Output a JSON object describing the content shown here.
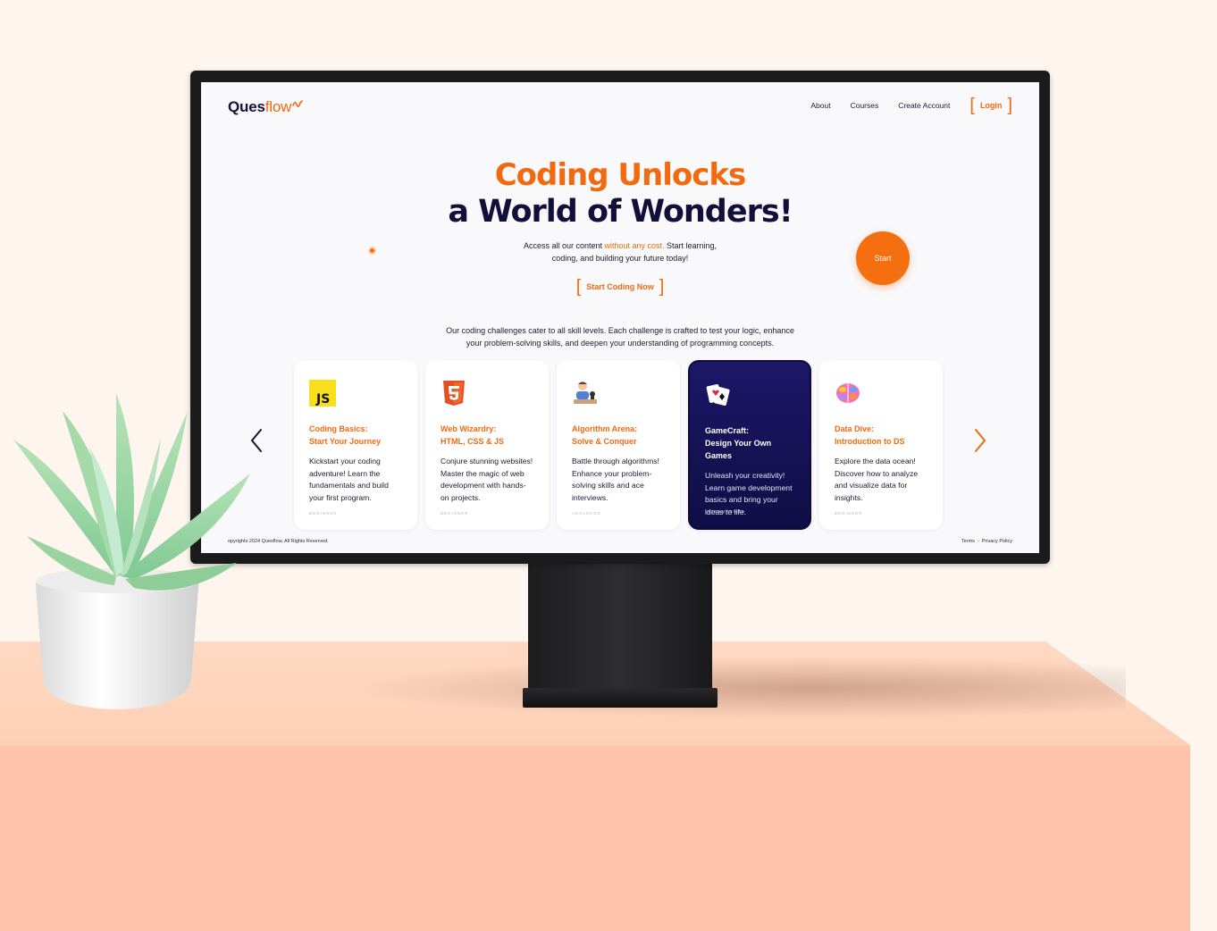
{
  "site": {
    "logo_main": "Ques",
    "logo_accent": "flow"
  },
  "nav": {
    "about": "About",
    "courses": "Courses",
    "create_account": "Create Account",
    "login": "Login"
  },
  "hero": {
    "title_line1": "Coding Unlocks",
    "title_line2": "a World of Wonders!",
    "sub_before": "Access all our content ",
    "sub_highlight": "without any cost.",
    "sub_after": " Start learning,",
    "sub_line2": "coding, and building your future today!",
    "cta_label": "Start Coding Now",
    "start_button": "Start"
  },
  "intro": {
    "line1": "Our coding challenges cater to all skill levels. Each challenge is crafted to test your logic, enhance",
    "line2": "your problem-solving skills, and deepen your understanding of programming concepts."
  },
  "cards": [
    {
      "icon": "javascript-icon",
      "title1": "Coding Basics:",
      "title2": "Start Your Journey",
      "desc": "Kickstart your coding adventure! Learn the fundamentals and build your first program.",
      "level": "Beginner"
    },
    {
      "icon": "html5-icon",
      "title1": "Web Wizardry:",
      "title2": "HTML, CSS & JS",
      "desc": "Conjure stunning websites! Master the magic of web development with hands-on projects.",
      "level": "Beginner"
    },
    {
      "icon": "chess-player-icon",
      "title1": "Algorithm Arena:",
      "title2": "Solve & Conquer",
      "desc": "Battle through algorithms! Enhance your problem-solving skills and ace interviews.",
      "level": "Advanced"
    },
    {
      "icon": "playing-cards-icon",
      "title1": "GameCraft:",
      "title2": "Design Your Own Games",
      "desc": "Unleash your creativity! Learn game development basics and bring your ideas to life.",
      "level": "Intermediate"
    },
    {
      "icon": "brain-icon",
      "title1": "Data Dive:",
      "title2": "Introduction to DS",
      "desc": "Explore the data ocean! Discover how to analyze and visualize data for insights.",
      "level": "Beginner"
    }
  ],
  "footer": {
    "copyright": "opyrights 2024 Quesflow, All Rights Reserved.",
    "terms": "Terms",
    "separator": "-",
    "privacy": "Privacy Policy"
  },
  "colors": {
    "accent": "#f26a0f",
    "navy": "#12103a",
    "background": "#fdf5ee",
    "desk": "#ffc5aa"
  }
}
